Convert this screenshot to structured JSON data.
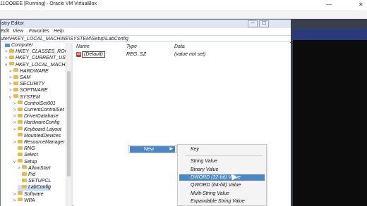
{
  "vbox": {
    "title": "11OOBEE [Running] - Oracle VM VirtualBox",
    "minimize": "—",
    "close": "✕"
  },
  "regedit": {
    "title": "istry Editor",
    "minimize": "─",
    "maximize": "☐",
    "menu": [
      "Edit",
      "View",
      "Favorites",
      "Help"
    ],
    "address": "uter\\HKEY_LOCAL_MACHINE\\SYSTEM\\Setup\\LabConfig",
    "columns": {
      "name": "Name",
      "type": "Type",
      "data": "Data"
    },
    "values": [
      {
        "icon": "ab",
        "name": "(Default)",
        "type": "REG_SZ",
        "data": "(value not set)"
      }
    ]
  },
  "tree": [
    {
      "label": "Computer",
      "indent": 0,
      "icon": "pc",
      "arrow": ""
    },
    {
      "label": "HKEY_CLASSES_ROOT",
      "indent": 1,
      "icon": "folder",
      "arrow": ">"
    },
    {
      "label": "HKEY_CURRENT_USER",
      "indent": 1,
      "icon": "folder",
      "arrow": ">"
    },
    {
      "label": "HKEY_LOCAL_MACHINE",
      "indent": 1,
      "icon": "folder",
      "arrow": "v"
    },
    {
      "label": "HARDWARE",
      "indent": 2,
      "icon": "folder",
      "arrow": ">"
    },
    {
      "label": "SAM",
      "indent": 2,
      "icon": "folder",
      "arrow": ">"
    },
    {
      "label": "SECURITY",
      "indent": 2,
      "icon": "folder",
      "arrow": ">"
    },
    {
      "label": "SOFTWARE",
      "indent": 2,
      "icon": "folder",
      "arrow": ">"
    },
    {
      "label": "SYSTEM",
      "indent": 2,
      "icon": "folder",
      "arrow": "v"
    },
    {
      "label": "ControlSet001",
      "indent": 3,
      "icon": "folder",
      "arrow": ">"
    },
    {
      "label": "CurrentControlSet",
      "indent": 3,
      "icon": "folder",
      "arrow": ">"
    },
    {
      "label": "DriverDatabase",
      "indent": 3,
      "icon": "folder",
      "arrow": ">"
    },
    {
      "label": "HardwareConfig",
      "indent": 3,
      "icon": "folder",
      "arrow": ">"
    },
    {
      "label": "Keyboard Layout",
      "indent": 3,
      "icon": "folder",
      "arrow": ">"
    },
    {
      "label": "MountedDevices",
      "indent": 3,
      "icon": "folder",
      "arrow": ""
    },
    {
      "label": "ResourceManager",
      "indent": 3,
      "icon": "folder",
      "arrow": ">"
    },
    {
      "label": "RNG",
      "indent": 3,
      "icon": "folder",
      "arrow": ""
    },
    {
      "label": "Select",
      "indent": 3,
      "icon": "folder",
      "arrow": ""
    },
    {
      "label": "Setup",
      "indent": 3,
      "icon": "folder",
      "arrow": "v"
    },
    {
      "label": "AllowStart",
      "indent": 4,
      "icon": "folder",
      "arrow": ">"
    },
    {
      "label": "Pid",
      "indent": 4,
      "icon": "folder",
      "arrow": ""
    },
    {
      "label": "SETUPCL",
      "indent": 4,
      "icon": "folder",
      "arrow": ""
    },
    {
      "label": "LabConfig",
      "indent": 4,
      "icon": "folder",
      "arrow": "",
      "selected": true
    },
    {
      "label": "Software",
      "indent": 3,
      "icon": "folder",
      "arrow": ">"
    },
    {
      "label": "WPA",
      "indent": 3,
      "icon": "folder",
      "arrow": ">"
    }
  ],
  "context_menu": {
    "new_label": "New",
    "submenu": [
      {
        "label": "Key",
        "highlighted": false
      },
      {
        "sep": true
      },
      {
        "label": "String Value",
        "highlighted": false
      },
      {
        "label": "Binary Value",
        "highlighted": false
      },
      {
        "label": "DWORD (32-bit) Value",
        "highlighted": true
      },
      {
        "label": "QWORD (64-bit) Value",
        "highlighted": false
      },
      {
        "label": "Multi-String Value",
        "highlighted": false
      },
      {
        "label": "Expandable String Value",
        "highlighted": false
      }
    ]
  },
  "colors": {
    "highlight": "#4a86c8",
    "folder": "#e9b84a"
  }
}
